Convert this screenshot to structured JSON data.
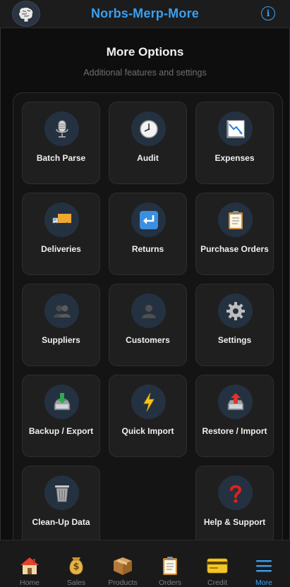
{
  "header": {
    "title": "Norbs-Merp-More",
    "info_label": "i"
  },
  "page": {
    "title": "More Options",
    "subtitle": "Additional features and settings"
  },
  "tiles": [
    {
      "label": "Batch Parse",
      "icon": "microphone-icon"
    },
    {
      "label": "Audit",
      "icon": "clock-icon"
    },
    {
      "label": "Expenses",
      "icon": "chart-decreasing-icon"
    },
    {
      "label": "Deliveries",
      "icon": "delivery-truck-icon"
    },
    {
      "label": "Returns",
      "icon": "return-arrow-icon"
    },
    {
      "label": "Purchase Orders",
      "icon": "clipboard-icon"
    },
    {
      "label": "Suppliers",
      "icon": "people-icon"
    },
    {
      "label": "Customers",
      "icon": "person-icon"
    },
    {
      "label": "Settings",
      "icon": "gear-icon"
    },
    {
      "label": "Backup / Export",
      "icon": "inbox-download-icon"
    },
    {
      "label": "Quick Import",
      "icon": "lightning-icon"
    },
    {
      "label": "Restore / Import",
      "icon": "outbox-upload-icon"
    },
    {
      "label": "Clean-Up Data",
      "icon": "wastebasket-icon"
    },
    {
      "label": "Help & Support",
      "icon": "question-mark-icon"
    }
  ],
  "nav": [
    {
      "label": "Home",
      "icon": "house-icon"
    },
    {
      "label": "Sales",
      "icon": "money-bag-icon"
    },
    {
      "label": "Products",
      "icon": "package-icon"
    },
    {
      "label": "Orders",
      "icon": "clipboard-icon"
    },
    {
      "label": "Credit",
      "icon": "credit-card-icon"
    },
    {
      "label": "More",
      "icon": "menu-icon",
      "active": true
    }
  ],
  "colors": {
    "accent": "#39a0f2",
    "background": "#0e0e0e",
    "tile": "#1f1f1f",
    "icon_circle": "#243140"
  }
}
